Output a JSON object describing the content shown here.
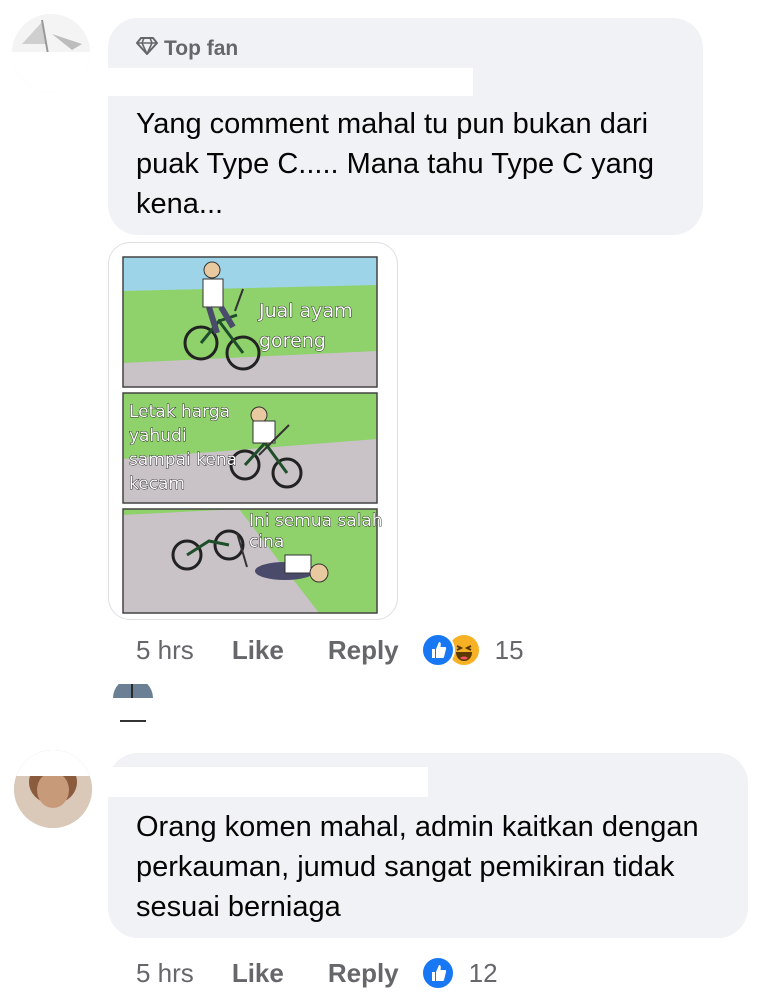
{
  "comments": [
    {
      "badge": "Top fan",
      "text": "Yang comment mahal tu pun bukan dari puak Type C..... Mana tahu Type C yang kena...",
      "meme": {
        "panel1": [
          "Jual ayam",
          "goreng"
        ],
        "panel2": [
          "Letak harga",
          "yahudi",
          "sampai kena",
          "kecam"
        ],
        "panel3": [
          "Ini semua salah",
          "cina"
        ]
      },
      "time": "5 hrs",
      "like_label": "Like",
      "reply_label": "Reply",
      "reactions": [
        "like-icon",
        "haha-icon"
      ],
      "reaction_count": "15"
    },
    {
      "text": "Orang komen mahal, admin kaitkan dengan perkauman, jumud sangat pemikiran tidak sesuai berniaga",
      "time": "5 hrs",
      "like_label": "Like",
      "reply_label": "Reply",
      "reactions": [
        "like-icon"
      ],
      "reaction_count": "12"
    }
  ],
  "colors": {
    "bubble": "#f0f2f5",
    "meta_text": "#65676b",
    "like_blue": "#1877f2",
    "haha_yellow": "#f7b125"
  }
}
